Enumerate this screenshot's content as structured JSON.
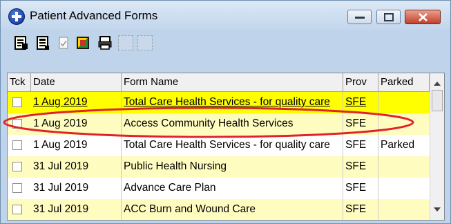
{
  "window": {
    "title": "Patient Advanced Forms"
  },
  "toolbar": {
    "icons": [
      "new-form-icon",
      "form-template-icon",
      "form-check-icon",
      "transfer-icon",
      "print-icon",
      "blank-button-icon",
      "blank-button-icon"
    ]
  },
  "table": {
    "columns": {
      "tck": "Tck",
      "date": "Date",
      "form": "Form Name",
      "prov": "Prov",
      "parked": "Parked"
    },
    "rows": [
      {
        "date": "1 Aug 2019",
        "form": "Total Care Health Services - for quality care",
        "prov": "SFE",
        "parked": ""
      },
      {
        "date": "1 Aug 2019",
        "form": "Access Community Health Services",
        "prov": "SFE",
        "parked": ""
      },
      {
        "date": "1 Aug 2019",
        "form": "Total Care Health Services - for quality care",
        "prov": "SFE",
        "parked": "Parked"
      },
      {
        "date": "31 Jul 2019",
        "form": "Public Health Nursing",
        "prov": "SFE",
        "parked": ""
      },
      {
        "date": "31 Jul 2019",
        "form": "Advance Care Plan",
        "prov": "SFE",
        "parked": ""
      },
      {
        "date": "31 Jul 2019",
        "form": "ACC Burn and Wound Care",
        "prov": "SFE",
        "parked": ""
      }
    ]
  },
  "colors": {
    "selected_row": "#ffff00",
    "highlight_row": "#fffcbf",
    "annotation": "#e0232b"
  }
}
